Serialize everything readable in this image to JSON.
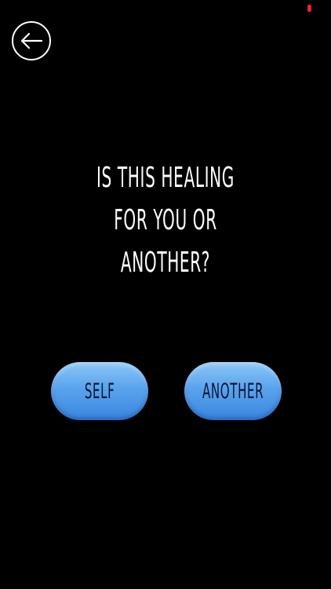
{
  "header": {
    "back_icon": "arrow-left-circle-icon"
  },
  "status": {
    "indicator_color": "#e8262a"
  },
  "question": {
    "lines": [
      "IS THIS HEALING",
      "FOR YOU OR",
      "ANOTHER?"
    ]
  },
  "choices": {
    "self_label": "SELF",
    "another_label": "ANOTHER",
    "button_color": "#5aa3ec",
    "label_color": "#0b1530"
  }
}
